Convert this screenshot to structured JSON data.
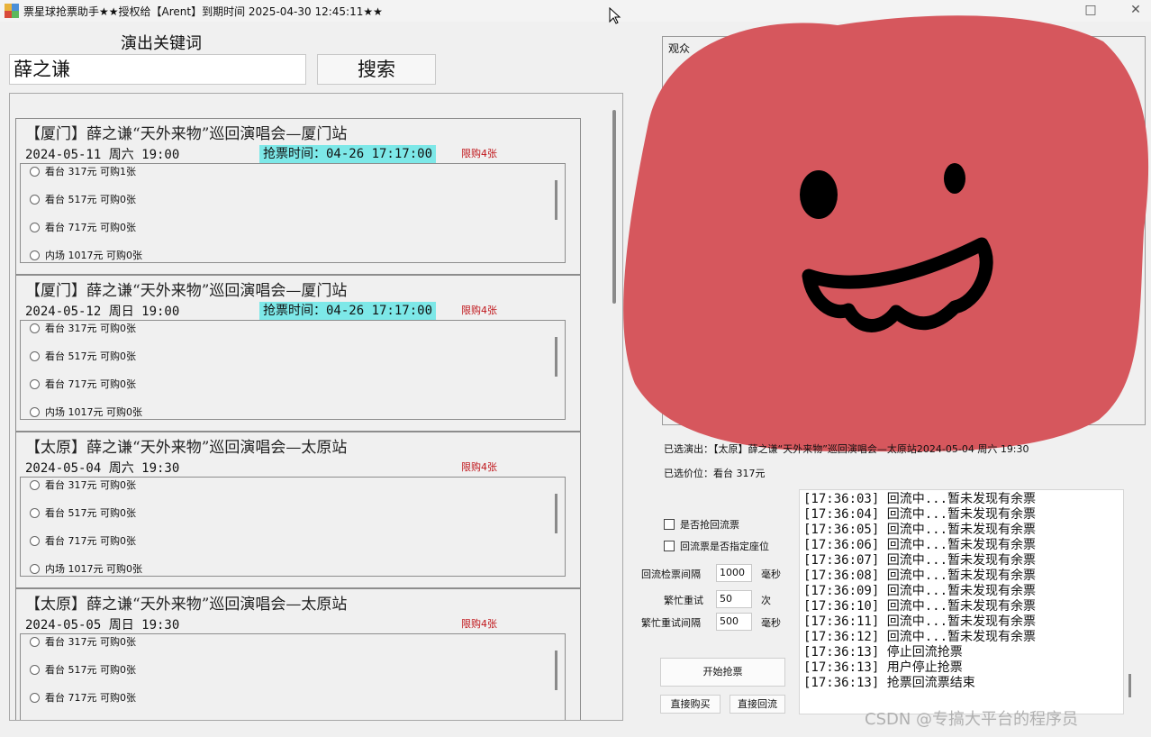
{
  "window": {
    "title": "票星球抢票助手★★授权给【Arent】到期时间 2025-04-30 12:45:11★★",
    "minimize_glyph": "─",
    "maximize_glyph": "□",
    "close_glyph": "✕"
  },
  "search": {
    "label": "演出关键词",
    "value": "薛之谦",
    "button": "搜索"
  },
  "events": [
    {
      "title": "【厦门】薛之谦“天外来物”巡回演唱会—厦门站",
      "date": "2024-05-11 周六 19:00",
      "sale_time": "抢票时间：04-26 17:17:00",
      "limit": "限购4张",
      "prices": [
        "看台 317元 可购1张",
        "看台 517元 可购0张",
        "看台 717元 可购0张",
        "内场 1017元 可购0张"
      ]
    },
    {
      "title": "【厦门】薛之谦“天外来物”巡回演唱会—厦门站",
      "date": "2024-05-12 周日 19:00",
      "sale_time": "抢票时间：04-26 17:17:00",
      "limit": "限购4张",
      "prices": [
        "看台 317元 可购0张",
        "看台 517元 可购0张",
        "看台 717元 可购0张",
        "内场 1017元 可购0张"
      ]
    },
    {
      "title": "【太原】薛之谦“天外来物”巡回演唱会—太原站",
      "date": "2024-05-04 周六 19:30",
      "sale_time": "",
      "limit": "限购4张",
      "prices": [
        "看台 317元 可购0张",
        "看台 517元 可购0张",
        "看台 717元 可购0张",
        "内场 1017元 可购0张"
      ]
    },
    {
      "title": "【太原】薛之谦“天外来物”巡回演唱会—太原站",
      "date": "2024-05-05 周日 19:30",
      "sale_time": "",
      "limit": "限购4张",
      "prices": [
        "看台 317元 可购0张",
        "看台 517元 可购0张",
        "看台 717元 可购0张"
      ]
    }
  ],
  "right": {
    "pick_label": "观众",
    "selected_show": "已选演出：【太原】薛之谦“天外来物”巡回演唱会—太原站2024-05-04 周六 19:30",
    "selected_price": "已选价位：看台 317元",
    "chk_resale": "是否抢回流票",
    "chk_seat": "回流票是否指定座位",
    "interval_label": "回流检票间隔",
    "interval_value": "1000",
    "interval_unit": "毫秒",
    "retry_label": "繁忙重试",
    "retry_value": "50",
    "retry_unit": "次",
    "retry_interval_label": "繁忙重试间隔",
    "retry_interval_value": "500",
    "retry_interval_unit": "毫秒",
    "start_button": "开始抢票",
    "buy_button": "直接购买",
    "resale_button": "直接回流"
  },
  "log": [
    "[17:36:03] 回流中...暂未发现有余票",
    "[17:36:04] 回流中...暂未发现有余票",
    "[17:36:05] 回流中...暂未发现有余票",
    "[17:36:06] 回流中...暂未发现有余票",
    "[17:36:07] 回流中...暂未发现有余票",
    "[17:36:08] 回流中...暂未发现有余票",
    "[17:36:09] 回流中...暂未发现有余票",
    "[17:36:10] 回流中...暂未发现有余票",
    "[17:36:11] 回流中...暂未发现有余票",
    "[17:36:12] 回流中...暂未发现有余票",
    "[17:36:13] 停止回流抢票",
    "[17:36:13] 用户停止抢票",
    "[17:36:13] 抢票回流票结束"
  ],
  "watermark": "CSDN @专搞大平台的程序员",
  "colors": {
    "sale_highlight": "#7de8e8",
    "limit_text": "#c0161b",
    "blob": "#d6575d"
  }
}
